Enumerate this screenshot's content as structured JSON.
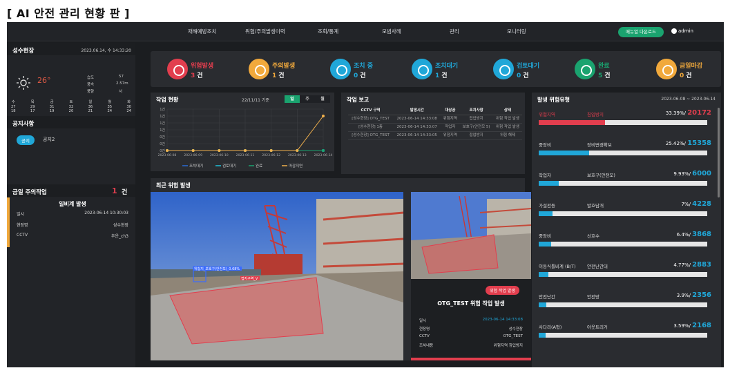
{
  "page_title": "[ AI 안전 관리 현황 판 ]",
  "nav": [
    "재해예방조치",
    "위험/주의발생이력",
    "조회/통계",
    "모범사례",
    "관리",
    "모니터링"
  ],
  "manual_button": "매뉴얼 다운로드",
  "user": "admin",
  "site": {
    "name": "성수현장",
    "datetime": "2023.06.14, 수 14:33:20",
    "temp": "26°",
    "wx": [
      {
        "k": "습도",
        "v": "57"
      },
      {
        "k": "풍속",
        "v": "2.57m"
      },
      {
        "k": "풍향",
        "v": "서"
      }
    ],
    "forecast": [
      {
        "d": "수",
        "a": "27",
        "b": "18"
      },
      {
        "d": "목",
        "a": "29",
        "b": "17"
      },
      {
        "d": "금",
        "a": "31",
        "b": "19"
      },
      {
        "d": "토",
        "a": "32",
        "b": "20"
      },
      {
        "d": "일",
        "a": "36",
        "b": "21"
      },
      {
        "d": "월",
        "a": "35",
        "b": "24"
      },
      {
        "d": "화",
        "a": "30",
        "b": "24"
      }
    ]
  },
  "notice": {
    "title": "공지사항",
    "badge": "공지",
    "text": "공지2"
  },
  "today_alert": {
    "title": "금일 주의작업",
    "count": "1",
    "unit": "건",
    "item_title": "일비계 발생",
    "rows": [
      {
        "k": "일시",
        "v": "2023-06-14 10:30:03"
      },
      {
        "k": "현장명",
        "v": "성수현장"
      },
      {
        "k": "CCTV",
        "v": "추운_ch3"
      }
    ]
  },
  "status_cards": [
    {
      "label": "위험발생",
      "count": "3",
      "unit": "건",
      "color": "#e23e4e"
    },
    {
      "label": "주의발생",
      "count": "1",
      "unit": "건",
      "color": "#f1a93c"
    },
    {
      "label": "조치 중",
      "count": "0",
      "unit": "건",
      "color": "#20a7d8"
    },
    {
      "label": "조치대기",
      "count": "1",
      "unit": "건",
      "color": "#20a7d8"
    },
    {
      "label": "검토대기",
      "count": "0",
      "unit": "건",
      "color": "#20a7d8"
    },
    {
      "label": "완료",
      "count": "5",
      "unit": "건",
      "color": "#1aa36f"
    },
    {
      "label": "금일마감",
      "count": "0",
      "unit": "건",
      "color": "#f1a93c"
    }
  ],
  "work_status": {
    "title": "작업 현황",
    "basis": "22/11/11 기준",
    "tabs": [
      "일",
      "주",
      "월"
    ]
  },
  "chart_data": {
    "type": "line",
    "x": [
      "2023-06-08",
      "2023-06-09",
      "2023-06-10",
      "2023-06-11",
      "2023-06-12",
      "2023-06-13",
      "2023-06-14"
    ],
    "y_ticks": [
      "0건",
      "0건",
      "0건",
      "1건",
      "1건",
      "1건",
      "1건"
    ],
    "series": [
      {
        "name": "조치대기",
        "color": "#2a6bd6",
        "values": [
          0,
          0,
          0,
          0,
          0,
          0,
          0
        ]
      },
      {
        "name": "검토대기",
        "color": "#20c0d8",
        "values": [
          0,
          0,
          0,
          0,
          0,
          0,
          0
        ]
      },
      {
        "name": "완료",
        "color": "#1aa36f",
        "values": [
          0,
          0,
          0,
          0,
          0,
          0,
          0
        ]
      },
      {
        "name": "마감지연",
        "color": "#f1b04c",
        "values": [
          0,
          0,
          0,
          0,
          0,
          0,
          1
        ]
      }
    ]
  },
  "report": {
    "title": "작업 보고",
    "headers": [
      "CCTV 구역",
      "발생시간",
      "대상공",
      "조치사항",
      "상태"
    ],
    "rows": [
      [
        "[성수현장] OTG_TEST",
        "2023-06-14 14:33:08",
        "위험지역",
        "접업방지",
        "위험 작업 발생"
      ],
      [
        "[성수현장] 1층",
        "2023-06-14 14:33:07",
        "작업자",
        "보호구(안전모 5)",
        "위험 작업 발생"
      ],
      [
        "[성수현장] OTG_TEST",
        "2023-06-14 14:33:05",
        "위험지역",
        "접업방지",
        "위험 해제"
      ]
    ]
  },
  "risk_types": {
    "title": "발생 위험유형",
    "range": "2023-06-08 ~ 2023-06-14",
    "items": [
      {
        "a": "위험지역",
        "b": "침입방지",
        "pct": "33.39%",
        "n": "20172",
        "v": 0.3339,
        "color": "#e23e4e"
      },
      {
        "a": "중장비",
        "b": "장비변경확보",
        "pct": "25.42%",
        "n": "15358",
        "v": 0.2542,
        "color": "#20a7d8"
      },
      {
        "a": "작업자",
        "b": "보호구(안전모)",
        "pct": "9.93%",
        "n": "6000",
        "v": 0.0993,
        "color": "#20a7d8"
      },
      {
        "a": "가설전등",
        "b": "발호담개",
        "pct": "7%",
        "n": "4228",
        "v": 0.07,
        "color": "#20a7d8"
      },
      {
        "a": "중장비",
        "b": "신호수",
        "pct": "6.4%",
        "n": "3868",
        "v": 0.064,
        "color": "#20a7d8"
      },
      {
        "a": "이동식틀비계 (B/T)",
        "b": "안전난간대",
        "pct": "4.77%",
        "n": "2883",
        "v": 0.0477,
        "color": "#20a7d8"
      },
      {
        "a": "안전난간",
        "b": "안전망",
        "pct": "3.9%",
        "n": "2356",
        "v": 0.039,
        "color": "#20a7d8"
      },
      {
        "a": "사다리(A형)",
        "b": "아웃트리거",
        "pct": "3.59%",
        "n": "2168",
        "v": 0.0359,
        "color": "#20a7d8"
      }
    ]
  },
  "recent": {
    "title": "최근 위험 발생",
    "detect1": "위험지_보호구(안전모)_0.68%",
    "detect2": "접지구역_V"
  },
  "detail": {
    "badge": "위험 작업 발생",
    "title": "OTG_TEST 위험 작업 발생",
    "rows": [
      {
        "k": "일시",
        "v": "2023-06-14 14:33:08"
      },
      {
        "k": "현장명",
        "v": "성수현장"
      },
      {
        "k": "CCTV",
        "v": "OTG_TEST"
      },
      {
        "k": "조치내용",
        "v": "위험지역 침입방지"
      }
    ]
  }
}
